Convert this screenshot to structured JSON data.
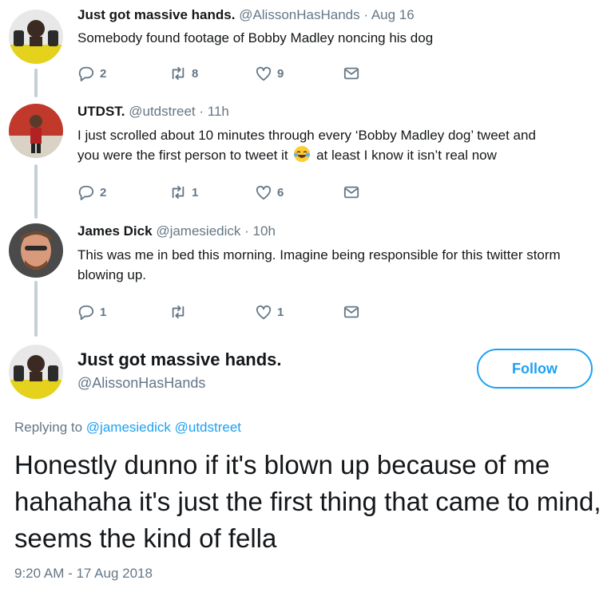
{
  "thread": [
    {
      "name": "Just got massive hands.",
      "handle": "@AlissonHasHands",
      "sep": "·",
      "time": "Aug 16",
      "text": "Somebody found footage of Bobby Madley noncing his dog",
      "replies": "2",
      "retweets": "8",
      "likes": "9"
    },
    {
      "name": "UTDST.",
      "handle": "@utdstreet",
      "sep": "·",
      "time": "11h",
      "text_line1": "I just scrolled about 10 minutes through every ‘Bobby Madley dog’ tweet and",
      "text_line2_a": "you were the first person to tweet it",
      "text_line2_b": "at least I know it isn’t real now",
      "replies": "2",
      "retweets": "1",
      "likes": "6"
    },
    {
      "name": "James Dick",
      "handle": "@jamesiedick",
      "sep": "·",
      "time": "10h",
      "text": "This was me in bed this morning. Imagine being responsible for this twitter storm blowing up.",
      "replies": "1",
      "retweets": "",
      "likes": "1"
    }
  ],
  "main_tweet": {
    "name": "Just got massive hands.",
    "handle": "@AlissonHasHands",
    "follow_label": "Follow",
    "replying_prefix": "Replying to",
    "replying_to_1": "@jamesiedick",
    "replying_to_2": "@utdstreet",
    "text": "Honestly dunno if it's blown up because of me hahahaha it's just the first thing that came to mind, seems the kind of fella",
    "timestamp": "9:20 AM - 17 Aug 2018"
  },
  "colors": {
    "accent": "#1da1f2",
    "muted": "#657786",
    "thread_line": "#c4cfd6"
  },
  "icons": [
    "reply-icon",
    "retweet-icon",
    "like-icon",
    "message-icon",
    "tears-of-joy-emoji"
  ]
}
